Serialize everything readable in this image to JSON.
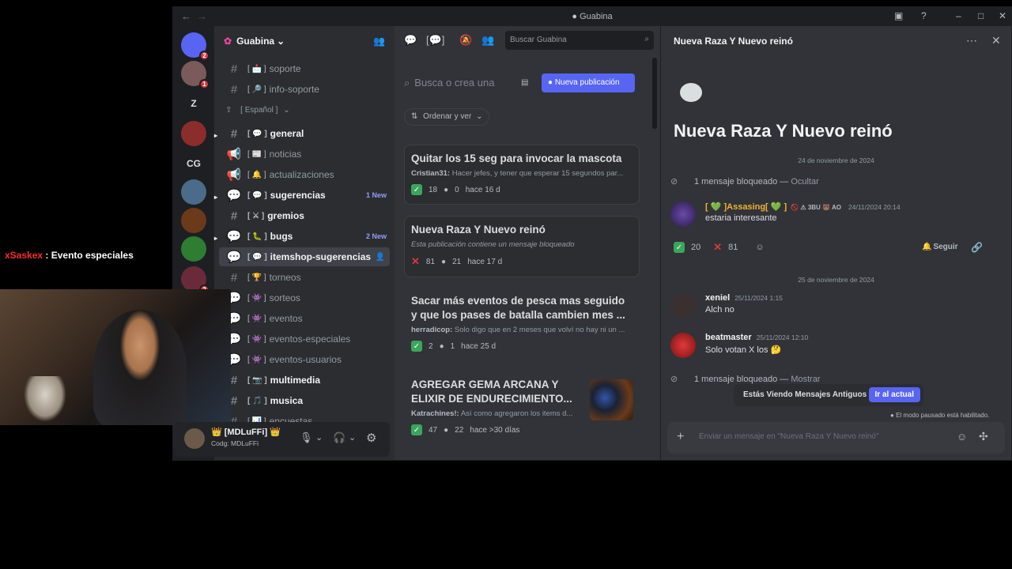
{
  "window": {
    "title": "Guabina",
    "back": "←",
    "forward": "→"
  },
  "guilds": {
    "items": [
      {
        "label": "",
        "color": "#5865f2",
        "badge": "2"
      },
      {
        "label": "",
        "color": "#7a5a5a",
        "badge": "1"
      },
      {
        "label": "Z",
        "color": "#1e1f22",
        "badge": ""
      },
      {
        "label": "",
        "color": "#8b2d2d",
        "badge": ""
      },
      {
        "label": "CG",
        "color": "#1e1f22",
        "badge": ""
      },
      {
        "label": "",
        "color": "#4a6b8a",
        "badge": ""
      },
      {
        "label": "",
        "color": "#6b3a1a",
        "badge": ""
      },
      {
        "label": "",
        "color": "#2e7d32",
        "badge": ""
      },
      {
        "label": "",
        "color": "#6b2a3a",
        "badge": "2"
      }
    ]
  },
  "server": {
    "name": "Guabina"
  },
  "channels": {
    "category": "[ Español ]",
    "items": [
      {
        "icon": "#",
        "emoji": "[ 📩 ]",
        "name": "soporte",
        "state": "muted",
        "new": ""
      },
      {
        "icon": "#",
        "emoji": "[ 🔎 ]",
        "name": "info-soporte",
        "state": "muted",
        "new": ""
      },
      {
        "icon": "#",
        "emoji": "[ 💬 ]",
        "name": "general",
        "state": "unread",
        "new": ""
      },
      {
        "icon": "📢",
        "emoji": "[ 📰 ]",
        "name": "noticias",
        "state": "muted",
        "new": ""
      },
      {
        "icon": "📢",
        "emoji": "[ 🔔 ]",
        "name": "actualizaciones",
        "state": "muted",
        "new": ""
      },
      {
        "icon": "💬",
        "emoji": "[ 💬 ]",
        "name": "sugerencias",
        "state": "unread",
        "new": "1 New"
      },
      {
        "icon": "#",
        "emoji": "[ ⚔ ]",
        "name": "gremios",
        "state": "unread",
        "new": ""
      },
      {
        "icon": "💬",
        "emoji": "[ 🐛 ]",
        "name": "bugs",
        "state": "unread",
        "new": "2 New"
      },
      {
        "icon": "💬",
        "emoji": "[ 💬 ]",
        "name": "itemshop-sugerencias",
        "state": "active",
        "new": ""
      },
      {
        "icon": "#",
        "emoji": "[ 🏆 ]",
        "name": "torneos",
        "state": "muted",
        "new": ""
      },
      {
        "icon": "💬",
        "emoji": "[ 👾 ]",
        "name": "sorteos",
        "state": "muted",
        "new": ""
      },
      {
        "icon": "💬",
        "emoji": "[ 👾 ]",
        "name": "eventos",
        "state": "muted",
        "new": ""
      },
      {
        "icon": "💬",
        "emoji": "[ 👾 ]",
        "name": "eventos-especiales",
        "state": "muted",
        "new": ""
      },
      {
        "icon": "💬",
        "emoji": "[ 👾 ]",
        "name": "eventos-usuarios",
        "state": "muted",
        "new": ""
      },
      {
        "icon": "#",
        "emoji": "[ 📷 ]",
        "name": "multimedia",
        "state": "unread",
        "new": ""
      },
      {
        "icon": "#",
        "emoji": "[ 🎵 ]",
        "name": "musica",
        "state": "unread",
        "new": ""
      },
      {
        "icon": "#",
        "emoji": "[ 📊 ]",
        "name": "encuestas",
        "state": "muted",
        "new": ""
      }
    ]
  },
  "user": {
    "name": "👑 [MDLuFFi] 👑",
    "status": "Codg: MDLuFFi"
  },
  "forum": {
    "search_placeholder": "Buscar Guabina",
    "post_search_placeholder": "Busca o crea una",
    "new_post": "Nueva publicación",
    "sort": "Ordenar y ver",
    "posts": [
      {
        "title": "Quitar los 15 seg para invocar la mascota",
        "author": "Cristian31:",
        "preview": "Hacer jefes, y tener que esperar 15 segundos par...",
        "r1": "18",
        "replies": "0",
        "time": "hace 16 d",
        "x": false
      },
      {
        "title": "Nueva Raza Y Nuevo reinó",
        "author": "",
        "preview": "Esta publicación contiene un mensaje bloqueado",
        "r1": "81",
        "replies": "21",
        "time": "hace 17 d",
        "x": true
      },
      {
        "title": "Sacar más eventos de pesca mas seguido y que los pases de batalla cambien mes ...",
        "author": "herradicop:",
        "preview": "Solo digo que en 2 meses que volví no hay ni un ...",
        "r1": "2",
        "replies": "1",
        "time": "hace 25 d",
        "x": false
      },
      {
        "title": "AGREGAR GEMA ARCANA Y ELIXIR DE ENDURECIMIENTO...",
        "author": "Katrachines!:",
        "preview": "Así como agregaron los items d...",
        "r1": "47",
        "replies": "22",
        "time": "hace >30 días",
        "x": false
      }
    ]
  },
  "thread": {
    "title": "Nueva Raza Y Nuevo reinó",
    "date1": "24 de noviembre de 2024",
    "blocked1": "1 mensaje bloqueado — ",
    "blocked1_link": "Ocultar",
    "op": {
      "name": "[ 💚 ]Assasing[ 💚 ]",
      "tags": "🚫 ⚠ 3BU 🐻 AO",
      "time": "24/11/2024 20:14",
      "text": "estaria interesante"
    },
    "reactions": {
      "check": "20",
      "x": "81"
    },
    "follow": "Seguir",
    "date2": "25 de noviembre de 2024",
    "m1": {
      "name": "xeniel",
      "time": "25/11/2024 1:15",
      "text": "Alch no"
    },
    "m2": {
      "name": "beatmaster",
      "time": "25/11/2024 12:10",
      "text": "Solo votan X los 🤔"
    },
    "blocked2": "1 mensaje bloqueado — ",
    "blocked2_link": "Mostrar",
    "old_banner": "Estás Viendo Mensajes Antiguos",
    "jump": "Ir al actual",
    "paused": "El modo pausado está habilitado.",
    "composer_placeholder": "Enviar un mensaje en \"Nueva Raza Y Nuevo reinó\""
  },
  "overlay": {
    "user": "xSaskex",
    "sep": " : ",
    "text": "Evento especiales"
  }
}
